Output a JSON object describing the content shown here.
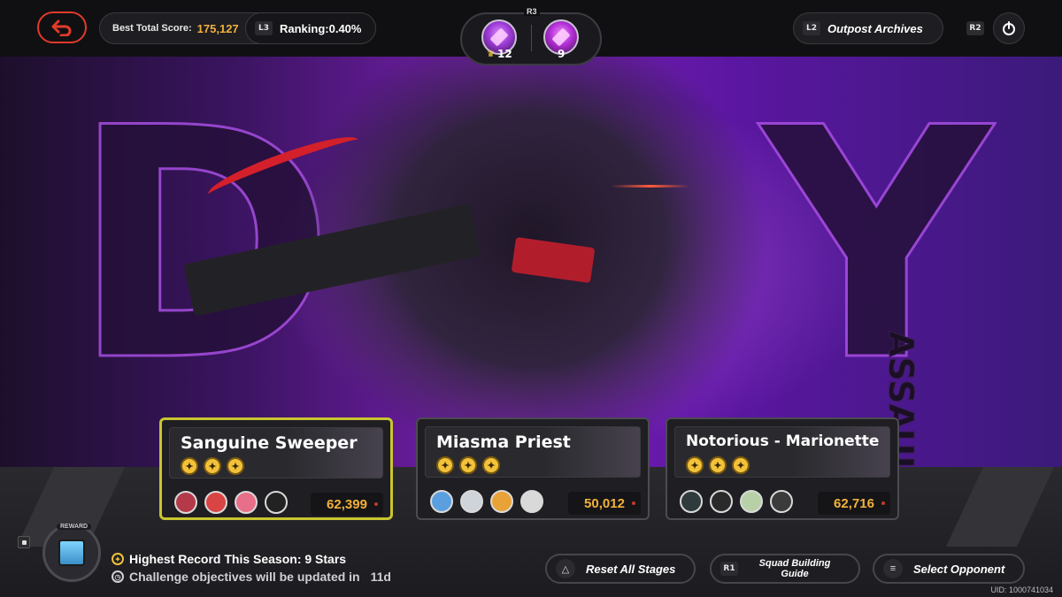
{
  "header": {
    "best_score_label": "Best Total Score:",
    "best_score_value": "175,127",
    "ranking_key": "L3",
    "ranking_text": "Ranking:0.40%",
    "badge_key": "R3",
    "badge_left_count": "12",
    "badge_right_count": "9",
    "archives_key": "L2",
    "archives_label": "Outpost Archives",
    "right_key": "R2"
  },
  "hero": {
    "title_partial_left": "D",
    "title_partial_right": "Y",
    "subtitle": "ASSAULT"
  },
  "stages": [
    {
      "name": "Sanguine Sweeper",
      "stars": 3,
      "score": "62,399",
      "selected": true,
      "squad_colors": [
        "#b43a4a",
        "#d94444",
        "#e86f8a",
        "#222"
      ]
    },
    {
      "name": "Miasma Priest",
      "stars": 3,
      "score": "50,012",
      "selected": false,
      "squad_colors": [
        "#5aa0e0",
        "#cfd3da",
        "#e8a238",
        "#d9d9d9"
      ]
    },
    {
      "name": "Notorious - Marionette",
      "stars": 3,
      "score": "62,716",
      "selected": false,
      "squad_colors": [
        "#2f3a3d",
        "#2a2a2a",
        "#b8d0a8",
        "#3b3b3b"
      ]
    }
  ],
  "footer": {
    "reward_label": "REWARD",
    "record_text": "Highest Record This Season: 9 Stars",
    "update_text": "Challenge objectives will be updated in",
    "update_days": "11d",
    "reset_label": "Reset All Stages",
    "squad_key": "R1",
    "squad_label": "Squad Building Guide",
    "select_label": "Select Opponent",
    "uid": "UID: 1000741034"
  },
  "colors": {
    "accent_gold": "#f3b13a",
    "back_red": "#e23a2a",
    "selected_border": "#c9c530",
    "hero_purple": "#7b1fb4"
  },
  "icons": [
    "back-arrow-icon",
    "medal-icon",
    "crown-icon",
    "power-icon",
    "star-coin-icon",
    "clock-icon",
    "triangle-icon",
    "menu-icon",
    "reward-icon"
  ]
}
